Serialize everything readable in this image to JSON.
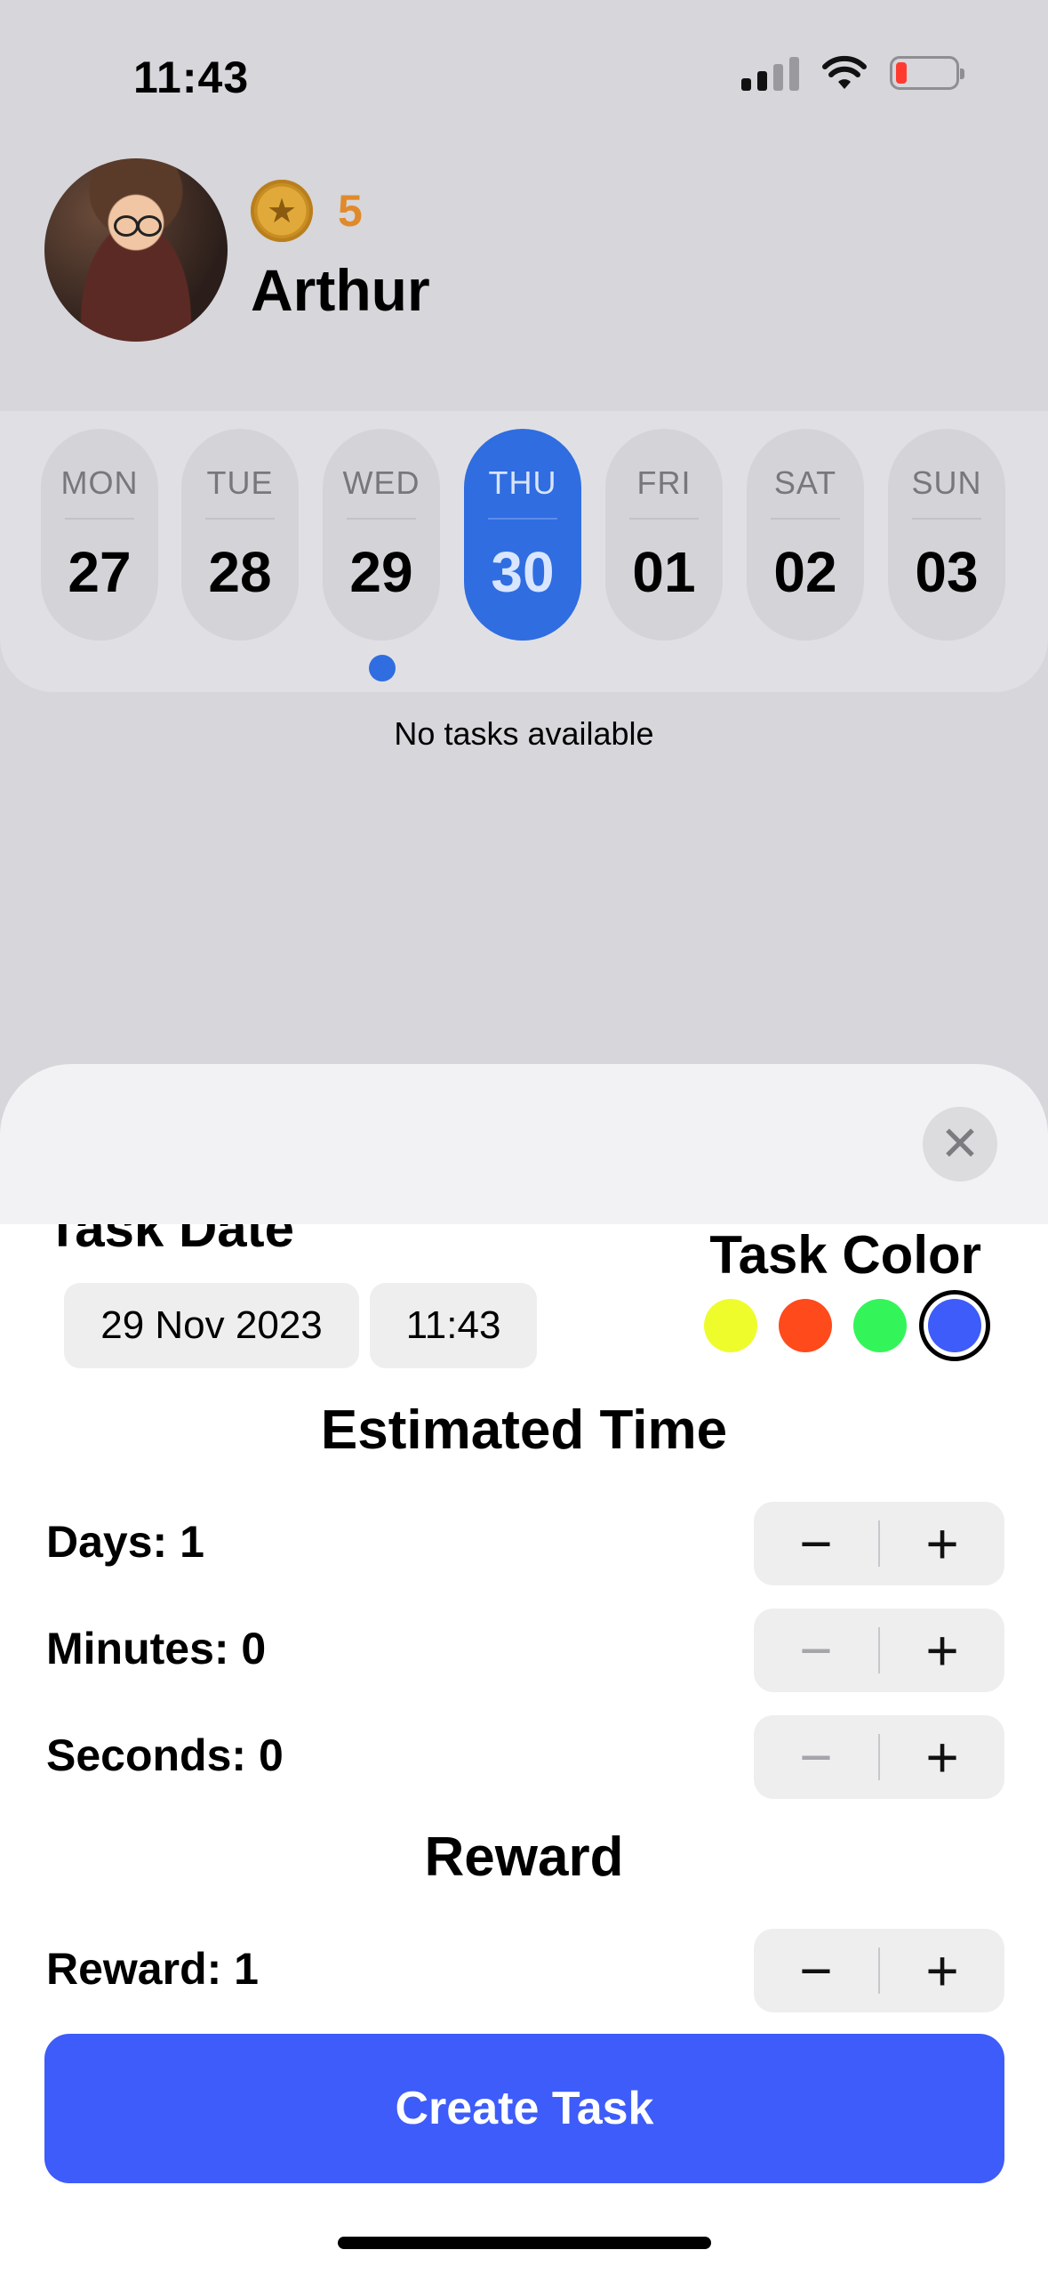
{
  "status_bar": {
    "time": "11:43"
  },
  "header": {
    "coins": "5",
    "username": "Arthur"
  },
  "week": [
    {
      "dow": "MON",
      "num": "27"
    },
    {
      "dow": "TUE",
      "num": "28"
    },
    {
      "dow": "WED",
      "num": "29"
    },
    {
      "dow": "THU",
      "num": "30",
      "active": true
    },
    {
      "dow": "FRI",
      "num": "01"
    },
    {
      "dow": "SAT",
      "num": "02"
    },
    {
      "dow": "SUN",
      "num": "03"
    }
  ],
  "tasks": {
    "empty_text": "No tasks available"
  },
  "sheet": {
    "task_date_label": "Task Date",
    "task_color_label": "Task Color",
    "date_value": "29 Nov 2023",
    "time_value": "11:43",
    "colors": [
      "#eefc2c",
      "#ff4a1c",
      "#33f55a",
      "#3e5cf9"
    ],
    "selected_color": "#3e5cf9",
    "estimated_time_title": "Estimated Time",
    "days_label": "Days: 1",
    "minutes_label": "Minutes: 0",
    "seconds_label": "Seconds: 0",
    "reward_title": "Reward",
    "reward_label": "Reward: 1",
    "stepper_minus": "−",
    "stepper_plus": "+",
    "create_button": "Create Task",
    "close_glyph": "✕"
  },
  "colors": {
    "accent": "#2f6de1",
    "button": "#3e5cf9",
    "coin_text": "#e08a2c"
  }
}
